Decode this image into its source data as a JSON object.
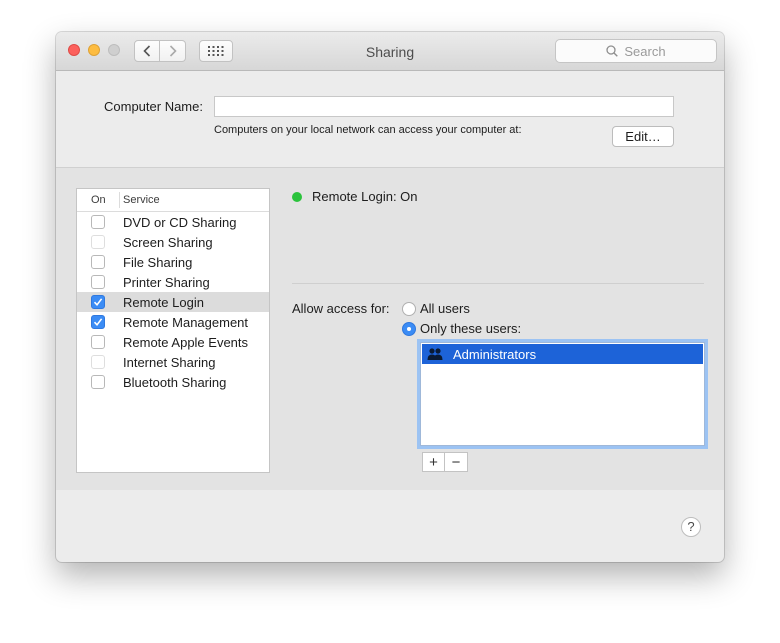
{
  "window": {
    "title": "Sharing"
  },
  "toolbar": {
    "back_icon": "chevron-left-icon",
    "forward_icon": "chevron-right-icon",
    "grid_icon": "grid-icon",
    "search_placeholder": "Search"
  },
  "computer_name": {
    "label": "Computer Name:",
    "value": "",
    "note": "Computers on your local network can access your computer at:",
    "edit_button": "Edit…"
  },
  "service_list": {
    "header_on": "On",
    "header_service": "Service",
    "items": [
      {
        "label": "DVD or CD Sharing",
        "checked": false
      },
      {
        "label": "Screen Sharing",
        "checked": false
      },
      {
        "label": "File Sharing",
        "checked": false
      },
      {
        "label": "Printer Sharing",
        "checked": false
      },
      {
        "label": "Remote Login",
        "checked": true
      },
      {
        "label": "Remote Management",
        "checked": true
      },
      {
        "label": "Remote Apple Events",
        "checked": false
      },
      {
        "label": "Internet Sharing",
        "checked": false
      },
      {
        "label": "Bluetooth Sharing",
        "checked": false
      }
    ]
  },
  "detail": {
    "status": "Remote Login: On",
    "status_color": "#2bc33c",
    "allow_label": "Allow access for:",
    "option_all": "All users",
    "option_only": "Only these users:",
    "selected_option": "Only these users:",
    "users": [
      "Administrators"
    ]
  },
  "buttons": {
    "add": "+",
    "remove": "−",
    "help": "?"
  },
  "colors": {
    "accent": "#3b8cf5",
    "selection": "#1d63d8"
  }
}
